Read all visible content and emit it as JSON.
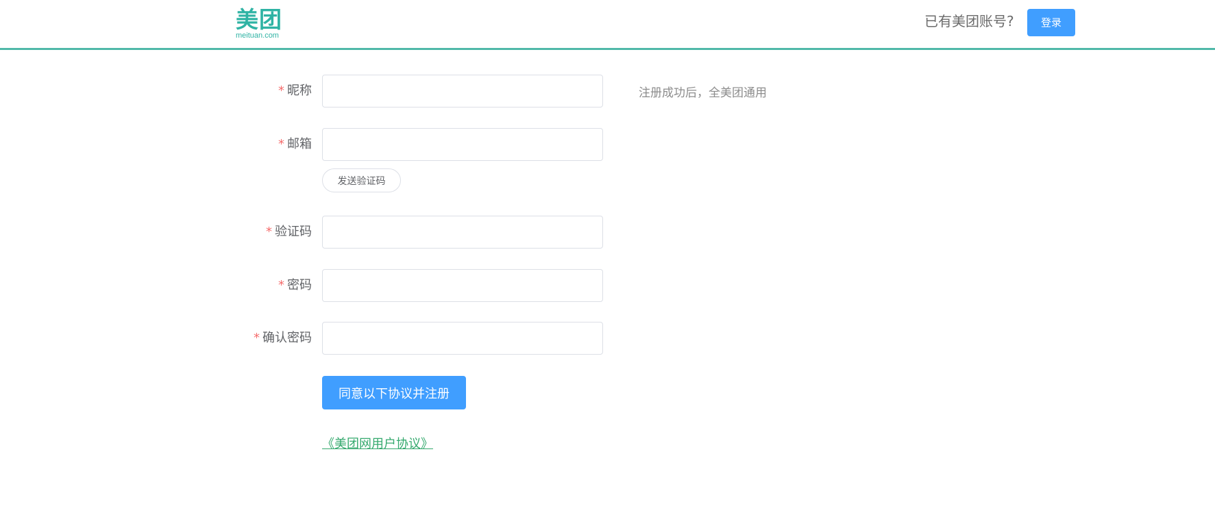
{
  "header": {
    "logo_cn": "美团",
    "logo_en": "meituan.com",
    "have_account_text": "已有美团账号?",
    "login_label": "登录"
  },
  "form": {
    "fields": [
      {
        "label": "昵称",
        "value": "",
        "required": true
      },
      {
        "label": "邮箱",
        "value": "",
        "required": true
      },
      {
        "label": "验证码",
        "value": "",
        "required": true
      },
      {
        "label": "密码",
        "value": "",
        "required": true
      },
      {
        "label": "确认密码",
        "value": "",
        "required": true
      }
    ],
    "required_mark": "*",
    "nickname_hint": "注册成功后，全美团通用",
    "send_code_label": "发送验证码",
    "submit_label": "同意以下协议并注册",
    "agreement_link": "《美团网用户协议》"
  },
  "colors": {
    "brand_green": "#2fb3a4",
    "header_border": "#4fb8a8",
    "primary_blue": "#409eff",
    "required_red": "#f56c6c",
    "link_green": "#35a96e"
  }
}
